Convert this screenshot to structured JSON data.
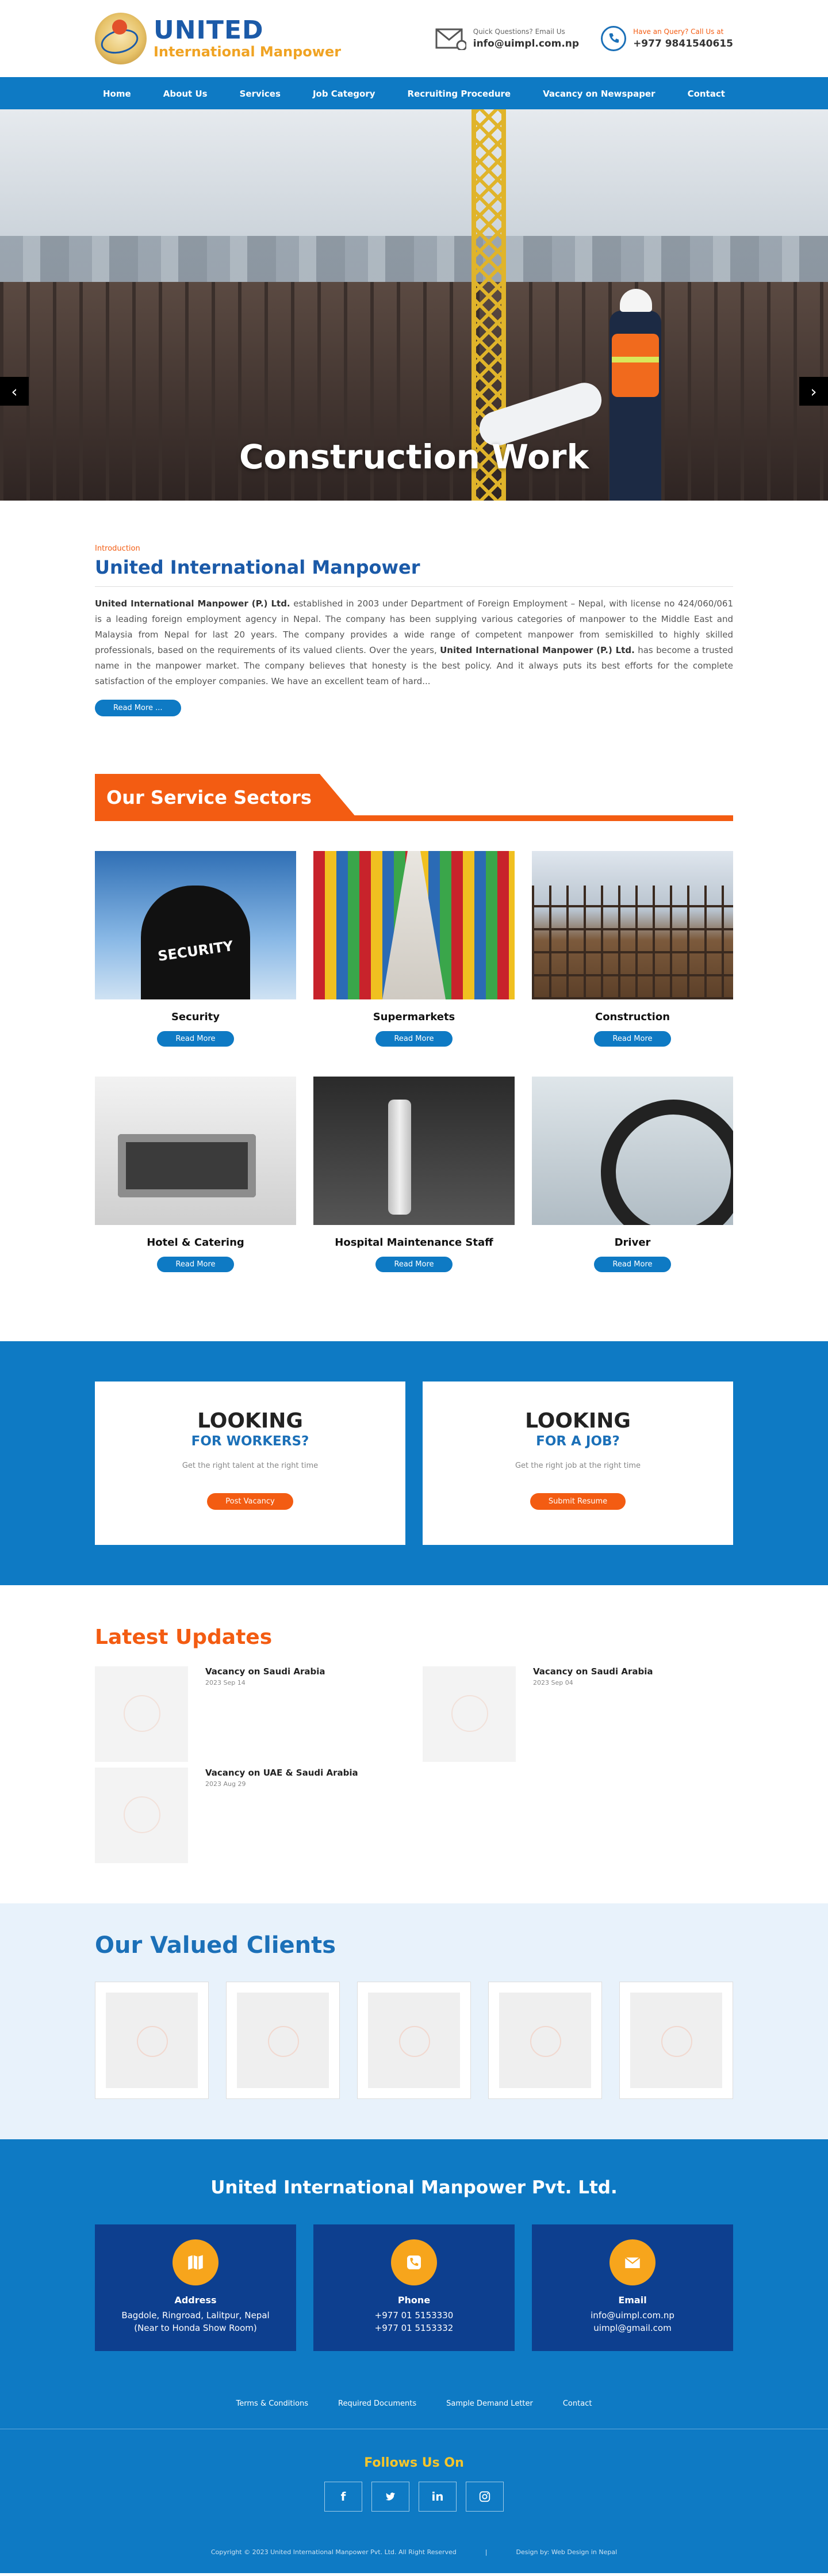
{
  "header": {
    "logo_line1": "UNITED",
    "logo_line2": "International Manpower",
    "email_label": "Quick Questions? Email Us",
    "email": "info@uimpl.com.np",
    "phone_label": "Have an Query? Call Us at",
    "phone": "+977 9841540615"
  },
  "nav": {
    "items": [
      "Home",
      "About Us",
      "Services",
      "Job Category",
      "Recruiting Procedure",
      "Vacancy on Newspaper",
      "Contact"
    ]
  },
  "hero": {
    "title": "Construction Work",
    "prev": "‹",
    "next": "›"
  },
  "intro": {
    "eyebrow": "Introduction",
    "title": "United International Manpower",
    "company_bold": "United International Manpower (P.) Ltd.",
    "text1": " established in 2003 under Department of Foreign Employment – Nepal, with license no 424/060/061 is a leading foreign employment agency in Nepal. The company has been supplying various categories of manpower to the Middle East and Malaysia from Nepal for last 20 years.  The company provides a wide range of competent manpower from semiskilled to highly skilled professionals, based on the requirements of its valued clients. Over the years, ",
    "company_bold2": "United International Manpower (P.) Ltd.",
    "text2": " has become a trusted name in the manpower market. The company believes that honesty is the best policy.  And it always puts its best efforts for the complete satisfaction of the employer companies. We have an excellent team of hard...",
    "read_more": "Read More ..."
  },
  "sectors": {
    "title": "Our Service Sectors",
    "read_more": "Read More",
    "items": [
      {
        "name": "Security",
        "img": "security",
        "sign": "SECURITY"
      },
      {
        "name": "Supermarkets",
        "img": "super"
      },
      {
        "name": "Construction",
        "img": "constr"
      },
      {
        "name": "Hotel & Catering",
        "img": "hotel"
      },
      {
        "name": "Hospital Maintenance Staff",
        "img": "hospital"
      },
      {
        "name": "Driver",
        "img": "driver"
      }
    ]
  },
  "looking": {
    "workers": {
      "t1": "LOOKING",
      "t2": "FOR WORKERS?",
      "t3": "Get the right talent at the right time",
      "btn": "Post Vacancy"
    },
    "job": {
      "t1": "LOOKING",
      "t2": "FOR A JOB?",
      "t3": "Get the right job at the right time",
      "btn": "Submit Resume"
    }
  },
  "updates": {
    "title": "Latest Updates",
    "items": [
      {
        "title": "Vacancy on Saudi Arabia",
        "date": "2023 Sep 14"
      },
      {
        "title": "Vacancy on Saudi Arabia",
        "date": "2023 Sep 04"
      },
      {
        "title": "Vacancy on UAE & Saudi Arabia",
        "date": "2023 Aug 29"
      }
    ]
  },
  "clients": {
    "title": "Our Valued Clients",
    "count_visible": 5
  },
  "footer": {
    "company": "United International Manpower Pvt. Ltd.",
    "address_h": "Address",
    "address_v1": "Bagdole, Ringroad, Lalitpur, Nepal",
    "address_v2": "(Near to Honda Show Room)",
    "phone_h": "Phone",
    "phone_v1": "+977 01 5153330",
    "phone_v2": "+977 01 5153332",
    "email_h": "Email",
    "email_v1": "info@uimpl.com.np",
    "email_v2": "uimpl@gmail.com",
    "links": [
      "Terms & Conditions",
      "Required Documents",
      "Sample Demand Letter",
      "Contact"
    ],
    "follow": "Follows Us On",
    "socials": [
      "f",
      "t",
      "in",
      "ig"
    ],
    "copyright": "Copyright © 2023 United International Manpower Pvt. Ltd. All Right Reserved",
    "sep": "|",
    "design": "Design by: Web Design in Nepal"
  }
}
